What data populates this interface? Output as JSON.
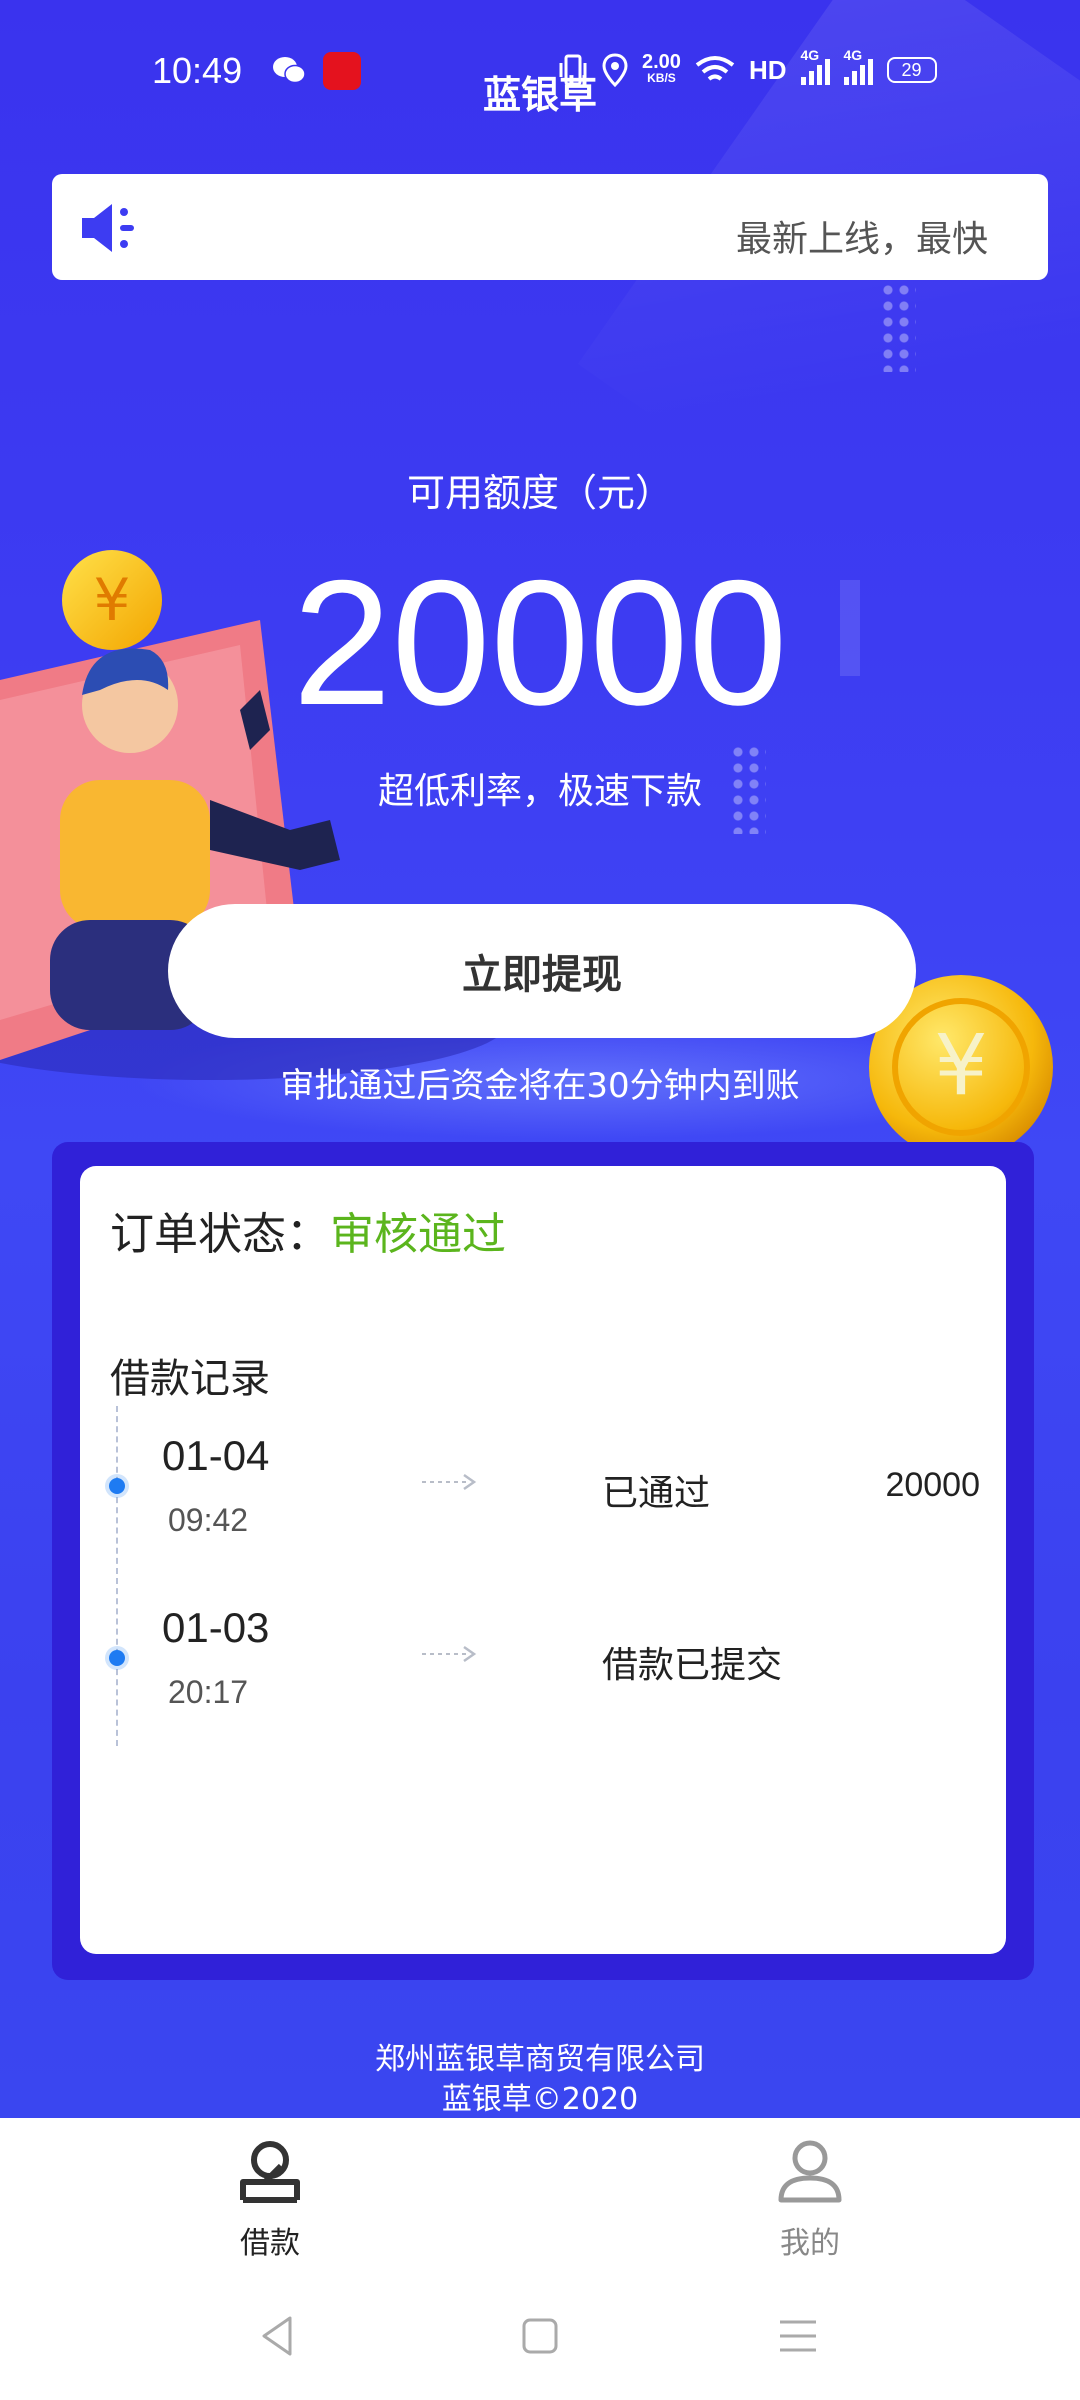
{
  "status_bar": {
    "time": "10:49",
    "net_speed_value": "2.00",
    "net_speed_unit": "KB/S",
    "network_type": "HD",
    "sim1": "4G",
    "sim2": "4G",
    "battery": "29"
  },
  "header": {
    "title": "蓝银草"
  },
  "notice": {
    "ticker_text": "最新上线，最快"
  },
  "credit": {
    "label": "可用额度（元）",
    "amount": "20000",
    "subtitle": "超低利率，极速下款"
  },
  "withdraw": {
    "button_label": "立即提现",
    "note": "审批通过后资金将在30分钟内到账"
  },
  "order": {
    "status_label": "订单状态：",
    "status_value": "审核通过",
    "status_color": "#5bb51d",
    "records_title": "借款记录",
    "records": [
      {
        "date": "01-04",
        "time": "09:42",
        "status": "已通过",
        "amount": "20000"
      },
      {
        "date": "01-03",
        "time": "20:17",
        "status": "借款已提交",
        "amount": ""
      }
    ]
  },
  "footer": {
    "company": "郑州蓝银草商贸有限公司",
    "copyright": "蓝银草©2020"
  },
  "tabs": [
    {
      "label": "借款",
      "icon": "loan-icon",
      "active": true
    },
    {
      "label": "我的",
      "icon": "user-icon",
      "active": false
    }
  ],
  "colors": {
    "primary_blue": "#3d3cf2",
    "card_frame": "#3021d8",
    "timeline_dot": "#1e7bf2"
  }
}
